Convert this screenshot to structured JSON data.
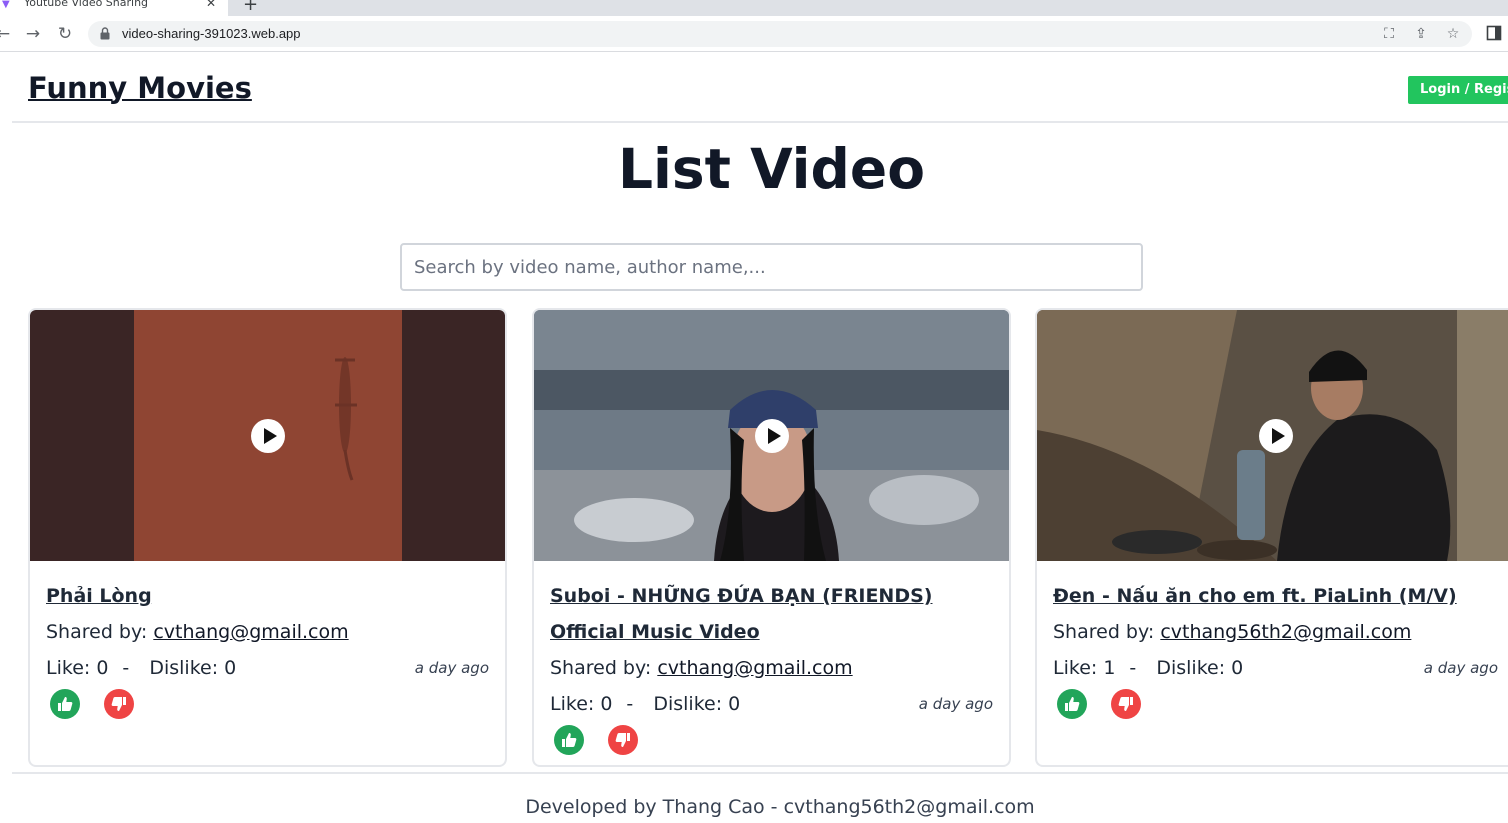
{
  "browser": {
    "tab_title": "Youtube Video Sharing",
    "url": "video-sharing-391023.web.app"
  },
  "header": {
    "brand": "Funny Movies",
    "login_label": "Login / Register"
  },
  "main": {
    "title": "List Video",
    "search_placeholder": "Search by video name, author name,..."
  },
  "videos": [
    {
      "title": "Phải Lòng",
      "shared_by_label": "Shared by:",
      "shared_by": "cvthang@gmail.com",
      "like_label": "Like:",
      "likes": "0",
      "dislike_label": "Dislike:",
      "dislikes": "0",
      "time": "a day ago"
    },
    {
      "title": "Suboi - NHỮNG ĐỨA BẠN (FRIENDS) Official Music Video",
      "shared_by_label": "Shared by:",
      "shared_by": "cvthang@gmail.com",
      "like_label": "Like:",
      "likes": "0",
      "dislike_label": "Dislike:",
      "dislikes": "0",
      "time": "a day ago"
    },
    {
      "title": "Đen - Nấu ăn cho em ft. PiaLinh (M/V)",
      "shared_by_label": "Shared by:",
      "shared_by": "cvthang56th2@gmail.com",
      "like_label": "Like:",
      "likes": "1",
      "dislike_label": "Dislike:",
      "dislikes": "0",
      "time": "a day ago"
    }
  ],
  "footer": {
    "text": "Developed by Thang Cao - cvthang56th2@gmail.com"
  },
  "colors": {
    "login_green": "#22c55e",
    "like_green": "#22a55a",
    "dislike_red": "#ef4444"
  }
}
